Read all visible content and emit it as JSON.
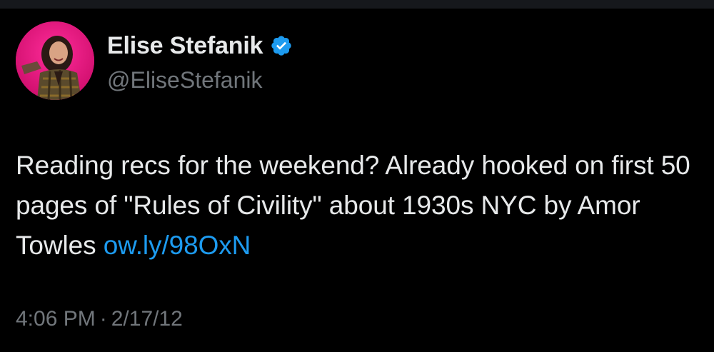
{
  "tweet": {
    "author": {
      "display_name": "Elise Stefanik",
      "handle": "@EliseStefanik",
      "verified": true,
      "avatar_icon": "profile-photo",
      "verified_icon": "verified-badge-icon"
    },
    "text_main": "Reading recs for the weekend? Already hooked on first 50 pages of \"Rules of Civility\" about 1930s NYC by Amor Towles ",
    "link_text": "ow.ly/98OxN",
    "time": "4:06 PM",
    "separator": "·",
    "date": "2/17/12"
  },
  "colors": {
    "background": "#000000",
    "text": "#e7e9ea",
    "secondary_text": "#71767b",
    "link": "#1d9bf0",
    "verified_badge": "#1d9bf0",
    "avatar_background": "#e8127e"
  }
}
